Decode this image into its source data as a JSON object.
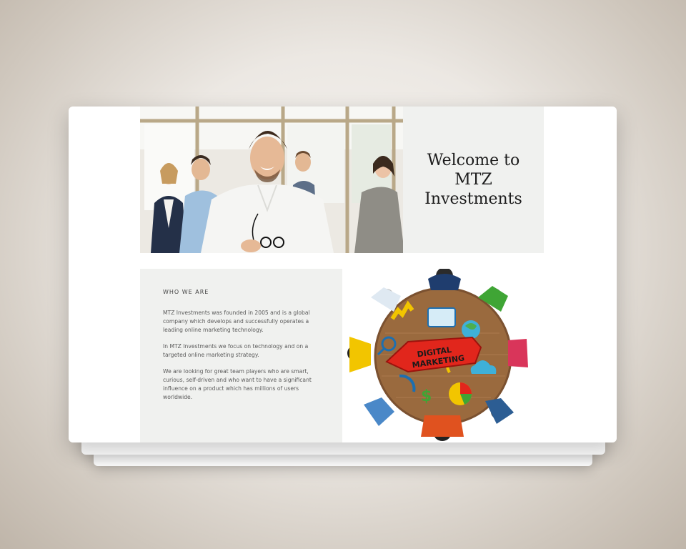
{
  "hero": {
    "title": "Welcome to MTZ Investments"
  },
  "about": {
    "heading": "WHO WE ARE",
    "paragraphs": [
      "MTZ Investments was founded in 2005 and is a global company which develops and successfully operates a leading online marketing technology.",
      "In MTZ Investments we focus on technology and on a targeted online marketing strategy.",
      "We are looking for great team players who are smart, curious, self-driven and who want to have a significant influence on a product which has millions of users worldwide."
    ]
  },
  "illustration": {
    "sign_line1": "DIGITAL",
    "sign_line2": "MARKETING"
  },
  "colors": {
    "panel": "#f0f1ef",
    "title": "#1c1c1c",
    "body_text": "#5a5a5a",
    "sign_red": "#e1261c"
  }
}
